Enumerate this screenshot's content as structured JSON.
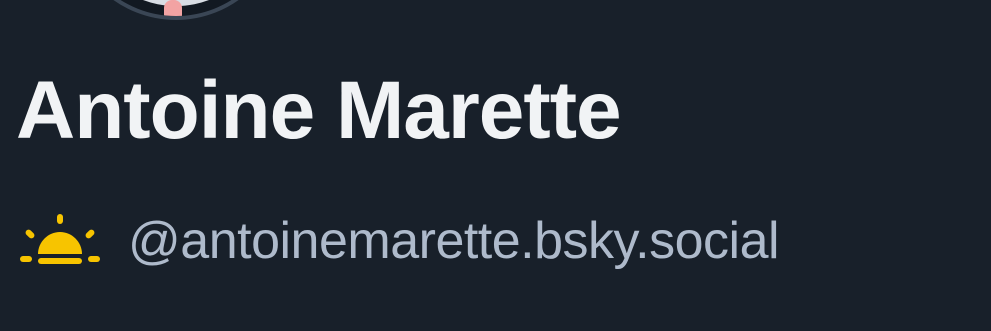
{
  "profile": {
    "display_name": "Antoine Marette",
    "handle": "@antoinemarette.bsky.social",
    "status_icon": "sunrise-icon"
  },
  "colors": {
    "background": "#18202a",
    "display_name": "#f1f3f5",
    "handle": "#aebacb",
    "icon_accent": "#f7c400"
  }
}
